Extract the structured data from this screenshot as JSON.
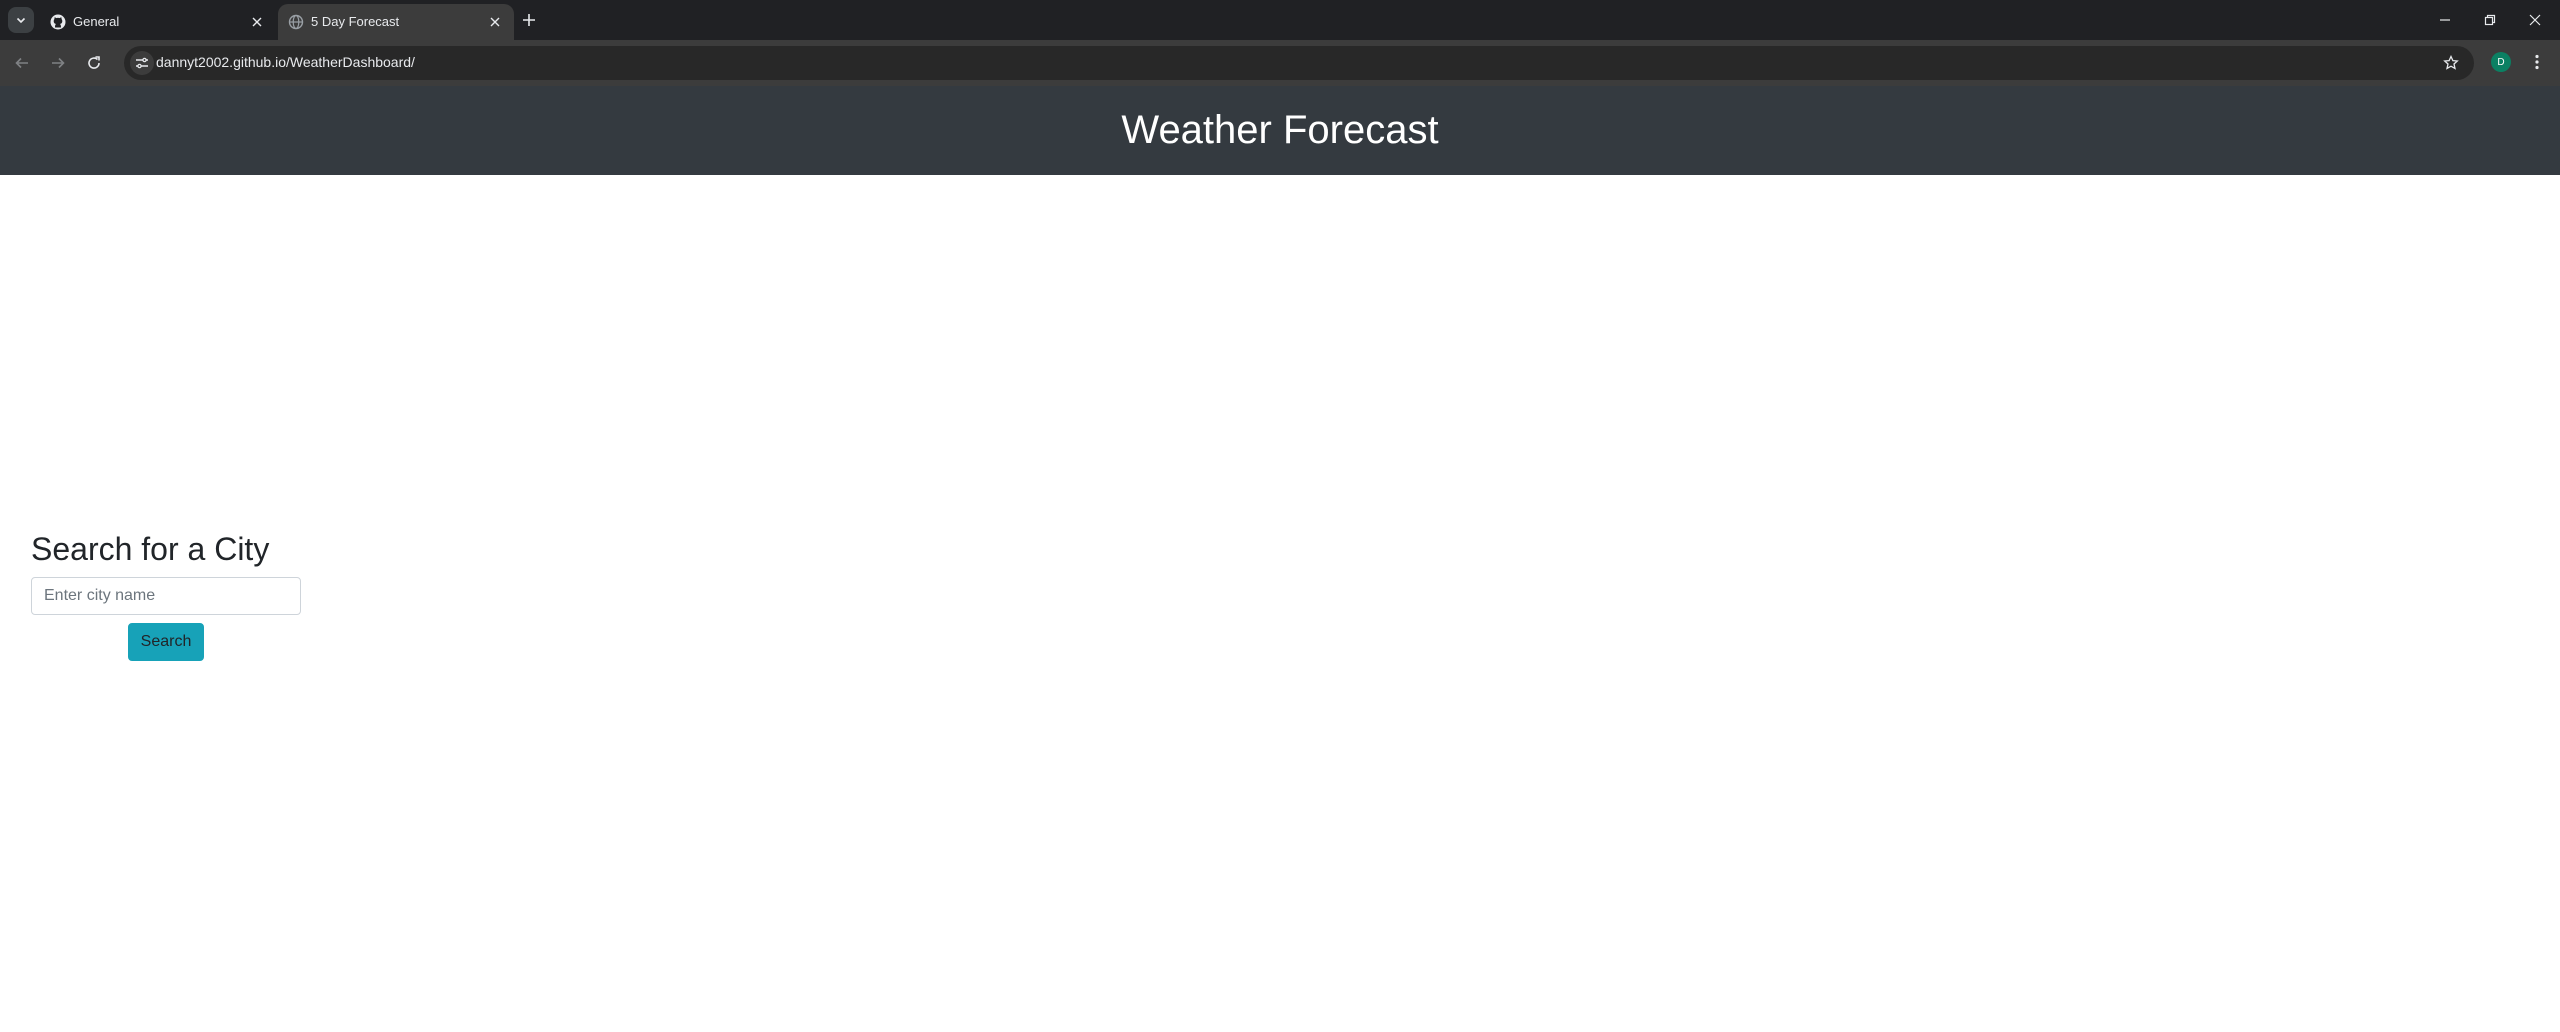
{
  "browser": {
    "tabs": [
      {
        "title": "General",
        "active": false,
        "icon": "github-icon"
      },
      {
        "title": "5 Day Forecast",
        "active": true,
        "icon": "globe-icon"
      }
    ],
    "url": "dannyt2002.github.io/WeatherDashboard/",
    "profile_initial": "D",
    "profile_color": "#0b8063"
  },
  "header": {
    "title": "Weather Forecast",
    "background": "#343a40"
  },
  "search": {
    "heading": "Search for a City",
    "placeholder": "Enter city name",
    "button_label": "Search",
    "button_color": "#17a2b8"
  }
}
